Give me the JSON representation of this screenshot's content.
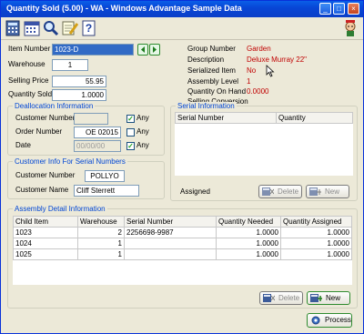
{
  "window": {
    "title": "Quantity Sold (5.00) - WA - Windows Advantage Sample Data"
  },
  "toolbar": {
    "icons": [
      "calculator-icon",
      "calendar-icon",
      "search-icon",
      "notepad-edit-icon",
      "help-icon",
      "mascot-icon"
    ]
  },
  "item_number": {
    "label": "Item Number",
    "value": "1023-D"
  },
  "warehouse": {
    "label": "Warehouse",
    "value": "1"
  },
  "selling_price": {
    "label": "Selling Price",
    "value": "55.95"
  },
  "quantity_sold": {
    "label": "Quantity Sold",
    "value": "1.0000"
  },
  "info": {
    "group_number": {
      "label": "Group Number",
      "value": "Garden"
    },
    "description": {
      "label": "Description",
      "value": "Deluxe Murray 22\""
    },
    "serialized_item": {
      "label": "Serialized Item",
      "value": "No"
    },
    "assembly_level": {
      "label": "Assembly Level",
      "value": "1"
    },
    "quantity_on_hand": {
      "label": "Quantity On Hand",
      "value": "0.0000"
    },
    "selling_conversion": {
      "label": "Selling Conversion",
      "value": ""
    }
  },
  "deallocation": {
    "title": "Deallocation Information",
    "customer_number": {
      "label": "Customer Number",
      "value": "",
      "any_label": "Any",
      "any_checked": true
    },
    "order_number": {
      "label": "Order Number",
      "value": "OE 02015",
      "any_label": "Any",
      "any_checked": false
    },
    "date": {
      "label": "Date",
      "value": "00/00/00",
      "any_label": "Any",
      "any_checked": true
    }
  },
  "serial_customer": {
    "title": "Customer Info For Serial Numbers",
    "customer_number": {
      "label": "Customer Number",
      "value": "POLLYO"
    },
    "customer_name": {
      "label": "Customer Name",
      "value": "Cliff Sterrett"
    }
  },
  "serial_info": {
    "title": "Serial Information",
    "columns": [
      "Serial Number",
      "Quantity"
    ],
    "assigned_label": "Assigned",
    "delete_label": "Delete",
    "new_label": "New"
  },
  "assembly": {
    "title": "Assembly Detail Information",
    "columns": [
      "Child Item",
      "Warehouse",
      "Serial Number",
      "Quantity Needed",
      "Quantity Assigned"
    ],
    "rows": [
      [
        "1023",
        "2",
        "2256698-9987",
        "1.0000",
        "1.0000"
      ],
      [
        "1024",
        "1",
        "",
        "1.0000",
        "1.0000"
      ],
      [
        "1025",
        "1",
        "",
        "1.0000",
        "1.0000"
      ]
    ],
    "delete_label": "Delete",
    "new_label": "New"
  },
  "process_label": "Process",
  "colors": {
    "title_blue": "#0a5fe8",
    "group_title": "#0046d5",
    "info_value": "#c00000"
  }
}
